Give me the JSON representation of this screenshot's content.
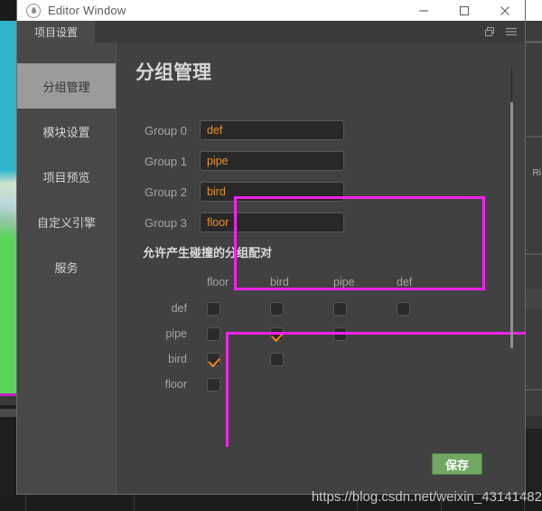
{
  "window": {
    "title": "Editor Window",
    "icon": "droplet-logo-icon",
    "controls": {
      "minimize": "minimize-icon",
      "maximize": "maximize-icon",
      "close": "close-icon"
    }
  },
  "tabbar": {
    "tabs": [
      {
        "label": "项目设置"
      }
    ],
    "icons": [
      {
        "name": "restore-window-icon"
      },
      {
        "name": "hamburger-menu-icon"
      }
    ]
  },
  "sidebar": {
    "items": [
      {
        "label": "分组管理",
        "active": true
      },
      {
        "label": "模块设置",
        "active": false
      },
      {
        "label": "项目预览",
        "active": false
      },
      {
        "label": "自定义引擎",
        "active": false
      },
      {
        "label": "服务",
        "active": false
      }
    ]
  },
  "main": {
    "page_title": "分组管理",
    "groups": {
      "rows": [
        {
          "label": "Group 0",
          "value": "def"
        },
        {
          "label": "Group 1",
          "value": "pipe"
        },
        {
          "label": "Group 2",
          "value": "bird"
        },
        {
          "label": "Group 3",
          "value": "floor"
        }
      ],
      "placeholder": ""
    },
    "collision": {
      "heading": "允许产生碰撞的分组配对",
      "columns": [
        "floor",
        "bird",
        "pipe",
        "def"
      ],
      "rows": [
        {
          "label": "def",
          "checks": [
            false,
            false,
            false,
            false
          ]
        },
        {
          "label": "pipe",
          "checks": [
            false,
            true,
            false
          ]
        },
        {
          "label": "bird",
          "checks": [
            true,
            false
          ]
        },
        {
          "label": "floor",
          "checks": [
            false
          ]
        }
      ]
    },
    "save_label": "保存"
  },
  "annotations": [
    {
      "name": "group-rows-highlight"
    },
    {
      "name": "collision-matrix-highlight"
    }
  ],
  "watermark": "https://blog.csdn.net/weixin_43141482",
  "background": {
    "right_label": "Ri",
    "watermark_tail": "82"
  },
  "colors": {
    "accent_orange": "#e8922a",
    "annotation_magenta": "#f221f2",
    "save_green": "#6fa763",
    "sky_cyan": "#2fb4cc",
    "ground_green": "#5cd45c"
  }
}
